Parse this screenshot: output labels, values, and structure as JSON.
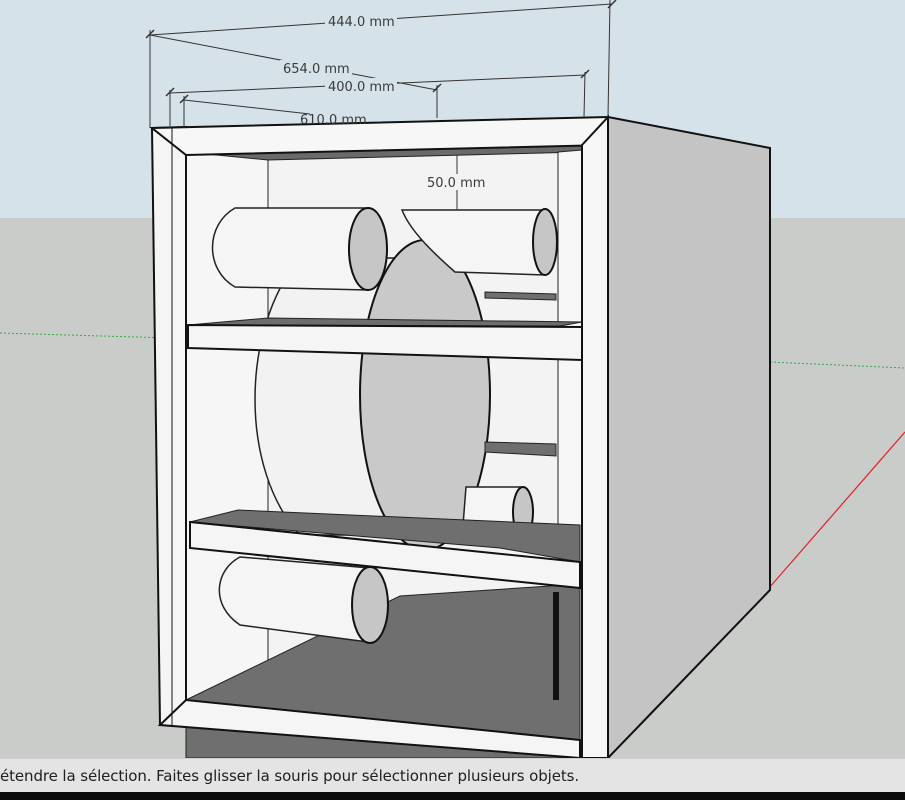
{
  "viewport": {
    "sky_color": "#d6e2ea",
    "ground_color": "#c9ccc8",
    "model_light": "#f4f4f4",
    "model_mid": "#c4c4c4",
    "model_shadow": "#6f6f6f",
    "axis_red": "#e0202a",
    "axis_green": "#3aa84a"
  },
  "dimensions": {
    "top_width": "444.0 mm",
    "diagonal_depth": "654.0 mm",
    "inner_width": "400.0 mm",
    "inner_depth": "610.0 mm",
    "gap": "50.0 mm"
  },
  "status_bar": {
    "text": "étendre la sélection. Faites glisser la souris pour sélectionner plusieurs objets."
  }
}
